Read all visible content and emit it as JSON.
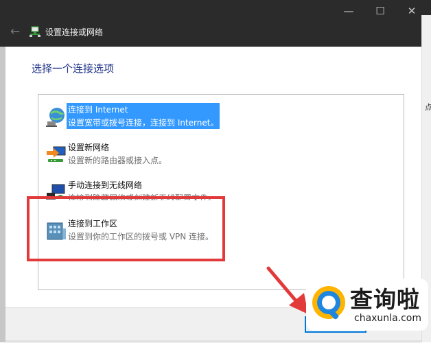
{
  "window": {
    "title": "设置连接或网络",
    "controls": {
      "minimize": "—",
      "maximize": "☐",
      "close": "✕"
    },
    "back_glyph": "←"
  },
  "background_fragment": "点",
  "dialog": {
    "heading": "选择一个连接选项",
    "options": [
      {
        "title": "连接到 Internet",
        "desc": "设置宽带或拨号连接，连接到 Internet。",
        "icon": "globe-network-icon",
        "selected": true
      },
      {
        "title": "设置新网络",
        "desc": "设置新的路由器或接入点。",
        "icon": "new-network-icon",
        "selected": false
      },
      {
        "title": "手动连接到无线网络",
        "desc": "连接到隐藏网络或创建新无线配置文件。",
        "icon": "wireless-icon",
        "selected": false
      },
      {
        "title": "连接到工作区",
        "desc": "设置到你的工作区的拨号或 VPN 连接。",
        "icon": "workplace-icon",
        "selected": false
      }
    ]
  },
  "watermark": {
    "name": "查询啦",
    "site": "chaxunla.com"
  },
  "colors": {
    "titlebar": "#2b2b2b",
    "selection": "#3399ff",
    "heading": "#1e3287",
    "annotation": "#e23a3a"
  }
}
